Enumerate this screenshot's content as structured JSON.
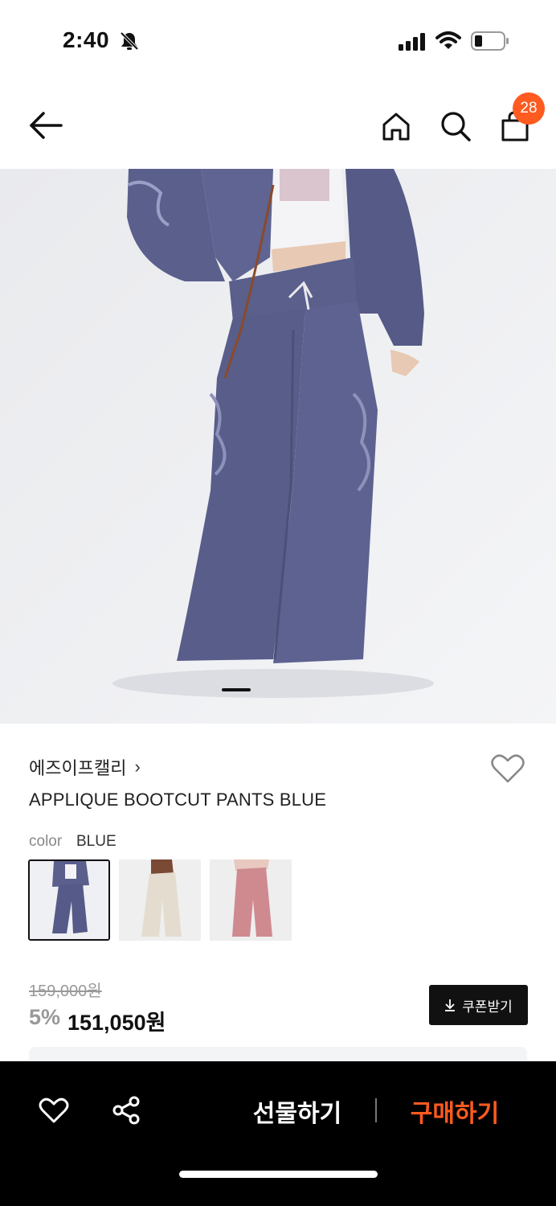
{
  "status_bar": {
    "time": "2:40"
  },
  "header": {
    "cart_count": "28"
  },
  "product": {
    "brand": "에즈이프캘리",
    "brand_chevron": "›",
    "title": "APPLIQUE BOOTCUT PANTS BLUE",
    "color_label": "color",
    "color_value": "BLUE",
    "swatches": [
      "navy-blue",
      "cream",
      "pink"
    ],
    "original_price": "159,000원",
    "discount": "5%",
    "sale_price": "151,050원",
    "coupon_label": "쿠폰받기"
  },
  "bottom_bar": {
    "gift_label": "선물하기",
    "buy_label": "구매하기"
  },
  "colors": {
    "accent": "#ff5a1f",
    "pants_blue": "#5a5f8c",
    "bottom_bar": "#000000"
  }
}
